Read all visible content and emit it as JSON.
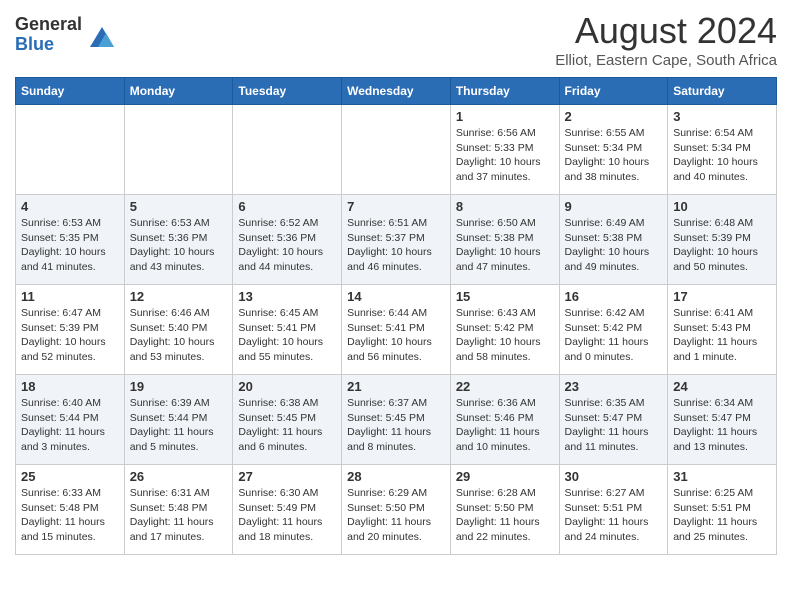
{
  "header": {
    "logo_general": "General",
    "logo_blue": "Blue",
    "title": "August 2024",
    "subtitle": "Elliot, Eastern Cape, South Africa"
  },
  "days_of_week": [
    "Sunday",
    "Monday",
    "Tuesday",
    "Wednesday",
    "Thursday",
    "Friday",
    "Saturday"
  ],
  "weeks": [
    [
      {
        "day": "",
        "info": ""
      },
      {
        "day": "",
        "info": ""
      },
      {
        "day": "",
        "info": ""
      },
      {
        "day": "",
        "info": ""
      },
      {
        "day": "1",
        "info": "Sunrise: 6:56 AM\nSunset: 5:33 PM\nDaylight: 10 hours and 37 minutes."
      },
      {
        "day": "2",
        "info": "Sunrise: 6:55 AM\nSunset: 5:34 PM\nDaylight: 10 hours and 38 minutes."
      },
      {
        "day": "3",
        "info": "Sunrise: 6:54 AM\nSunset: 5:34 PM\nDaylight: 10 hours and 40 minutes."
      }
    ],
    [
      {
        "day": "4",
        "info": "Sunrise: 6:53 AM\nSunset: 5:35 PM\nDaylight: 10 hours and 41 minutes."
      },
      {
        "day": "5",
        "info": "Sunrise: 6:53 AM\nSunset: 5:36 PM\nDaylight: 10 hours and 43 minutes."
      },
      {
        "day": "6",
        "info": "Sunrise: 6:52 AM\nSunset: 5:36 PM\nDaylight: 10 hours and 44 minutes."
      },
      {
        "day": "7",
        "info": "Sunrise: 6:51 AM\nSunset: 5:37 PM\nDaylight: 10 hours and 46 minutes."
      },
      {
        "day": "8",
        "info": "Sunrise: 6:50 AM\nSunset: 5:38 PM\nDaylight: 10 hours and 47 minutes."
      },
      {
        "day": "9",
        "info": "Sunrise: 6:49 AM\nSunset: 5:38 PM\nDaylight: 10 hours and 49 minutes."
      },
      {
        "day": "10",
        "info": "Sunrise: 6:48 AM\nSunset: 5:39 PM\nDaylight: 10 hours and 50 minutes."
      }
    ],
    [
      {
        "day": "11",
        "info": "Sunrise: 6:47 AM\nSunset: 5:39 PM\nDaylight: 10 hours and 52 minutes."
      },
      {
        "day": "12",
        "info": "Sunrise: 6:46 AM\nSunset: 5:40 PM\nDaylight: 10 hours and 53 minutes."
      },
      {
        "day": "13",
        "info": "Sunrise: 6:45 AM\nSunset: 5:41 PM\nDaylight: 10 hours and 55 minutes."
      },
      {
        "day": "14",
        "info": "Sunrise: 6:44 AM\nSunset: 5:41 PM\nDaylight: 10 hours and 56 minutes."
      },
      {
        "day": "15",
        "info": "Sunrise: 6:43 AM\nSunset: 5:42 PM\nDaylight: 10 hours and 58 minutes."
      },
      {
        "day": "16",
        "info": "Sunrise: 6:42 AM\nSunset: 5:42 PM\nDaylight: 11 hours and 0 minutes."
      },
      {
        "day": "17",
        "info": "Sunrise: 6:41 AM\nSunset: 5:43 PM\nDaylight: 11 hours and 1 minute."
      }
    ],
    [
      {
        "day": "18",
        "info": "Sunrise: 6:40 AM\nSunset: 5:44 PM\nDaylight: 11 hours and 3 minutes."
      },
      {
        "day": "19",
        "info": "Sunrise: 6:39 AM\nSunset: 5:44 PM\nDaylight: 11 hours and 5 minutes."
      },
      {
        "day": "20",
        "info": "Sunrise: 6:38 AM\nSunset: 5:45 PM\nDaylight: 11 hours and 6 minutes."
      },
      {
        "day": "21",
        "info": "Sunrise: 6:37 AM\nSunset: 5:45 PM\nDaylight: 11 hours and 8 minutes."
      },
      {
        "day": "22",
        "info": "Sunrise: 6:36 AM\nSunset: 5:46 PM\nDaylight: 11 hours and 10 minutes."
      },
      {
        "day": "23",
        "info": "Sunrise: 6:35 AM\nSunset: 5:47 PM\nDaylight: 11 hours and 11 minutes."
      },
      {
        "day": "24",
        "info": "Sunrise: 6:34 AM\nSunset: 5:47 PM\nDaylight: 11 hours and 13 minutes."
      }
    ],
    [
      {
        "day": "25",
        "info": "Sunrise: 6:33 AM\nSunset: 5:48 PM\nDaylight: 11 hours and 15 minutes."
      },
      {
        "day": "26",
        "info": "Sunrise: 6:31 AM\nSunset: 5:48 PM\nDaylight: 11 hours and 17 minutes."
      },
      {
        "day": "27",
        "info": "Sunrise: 6:30 AM\nSunset: 5:49 PM\nDaylight: 11 hours and 18 minutes."
      },
      {
        "day": "28",
        "info": "Sunrise: 6:29 AM\nSunset: 5:50 PM\nDaylight: 11 hours and 20 minutes."
      },
      {
        "day": "29",
        "info": "Sunrise: 6:28 AM\nSunset: 5:50 PM\nDaylight: 11 hours and 22 minutes."
      },
      {
        "day": "30",
        "info": "Sunrise: 6:27 AM\nSunset: 5:51 PM\nDaylight: 11 hours and 24 minutes."
      },
      {
        "day": "31",
        "info": "Sunrise: 6:25 AM\nSunset: 5:51 PM\nDaylight: 11 hours and 25 minutes."
      }
    ]
  ]
}
